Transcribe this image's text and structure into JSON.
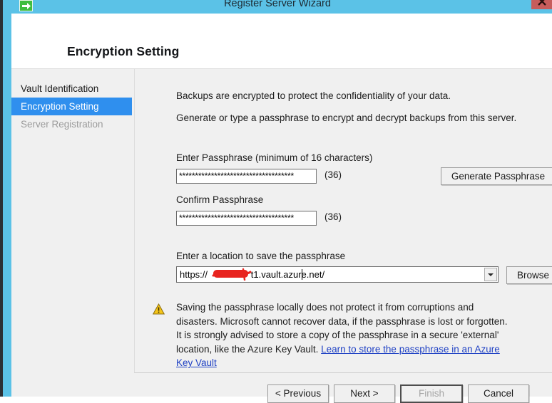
{
  "window": {
    "title": "Register Server Wizard",
    "app_icon": "arrow-right-icon",
    "close_icon": "close-icon",
    "frame_color": "#5bc2e7",
    "close_button_color": "#c75c5c"
  },
  "header": {
    "page_title": "Encryption Setting"
  },
  "sidebar": {
    "items": [
      {
        "label": "Vault Identification",
        "state": "normal"
      },
      {
        "label": "Encryption Setting",
        "state": "selected"
      },
      {
        "label": "Server Registration",
        "state": "disabled"
      }
    ],
    "selected_color": "#2f8fee"
  },
  "content": {
    "intro_line_1": "Backups are encrypted to protect the confidentiality of your data.",
    "intro_line_2": "Generate or type a passphrase to encrypt and decrypt backups from this server.",
    "passphrase": {
      "label": "Enter Passphrase (minimum of 16 characters)",
      "value": "************************************",
      "count": "(36)"
    },
    "confirm_passphrase": {
      "label": "Confirm Passphrase",
      "value": "************************************",
      "count": "(36)"
    },
    "generate_button": "Generate Passphrase",
    "location": {
      "label": "Enter a location to save the passphrase",
      "value_prefix": "https://",
      "value_suffix": "t1.vault.azure.net/",
      "redacted": true,
      "redaction_color": "#e8241f",
      "dropdown_icon": "chevron-down-icon"
    },
    "browse_button": "Browse",
    "warning": {
      "icon": "warning-triangle-icon",
      "text": "Saving the passphrase locally does not protect it from corruptions and disasters. Microsoft cannot recover data, if the passphrase is lost or forgotten. It is strongly advised to store a copy of the passphrase in a secure 'external' location, like the Azure Key Vault. ",
      "link_text": "Learn to store the passphrase in an Azure Key Vault",
      "link_color": "#1f41c4"
    }
  },
  "footer": {
    "previous": "< Previous",
    "next": "Next >",
    "finish": "Finish",
    "cancel": "Cancel",
    "finish_enabled": false
  }
}
